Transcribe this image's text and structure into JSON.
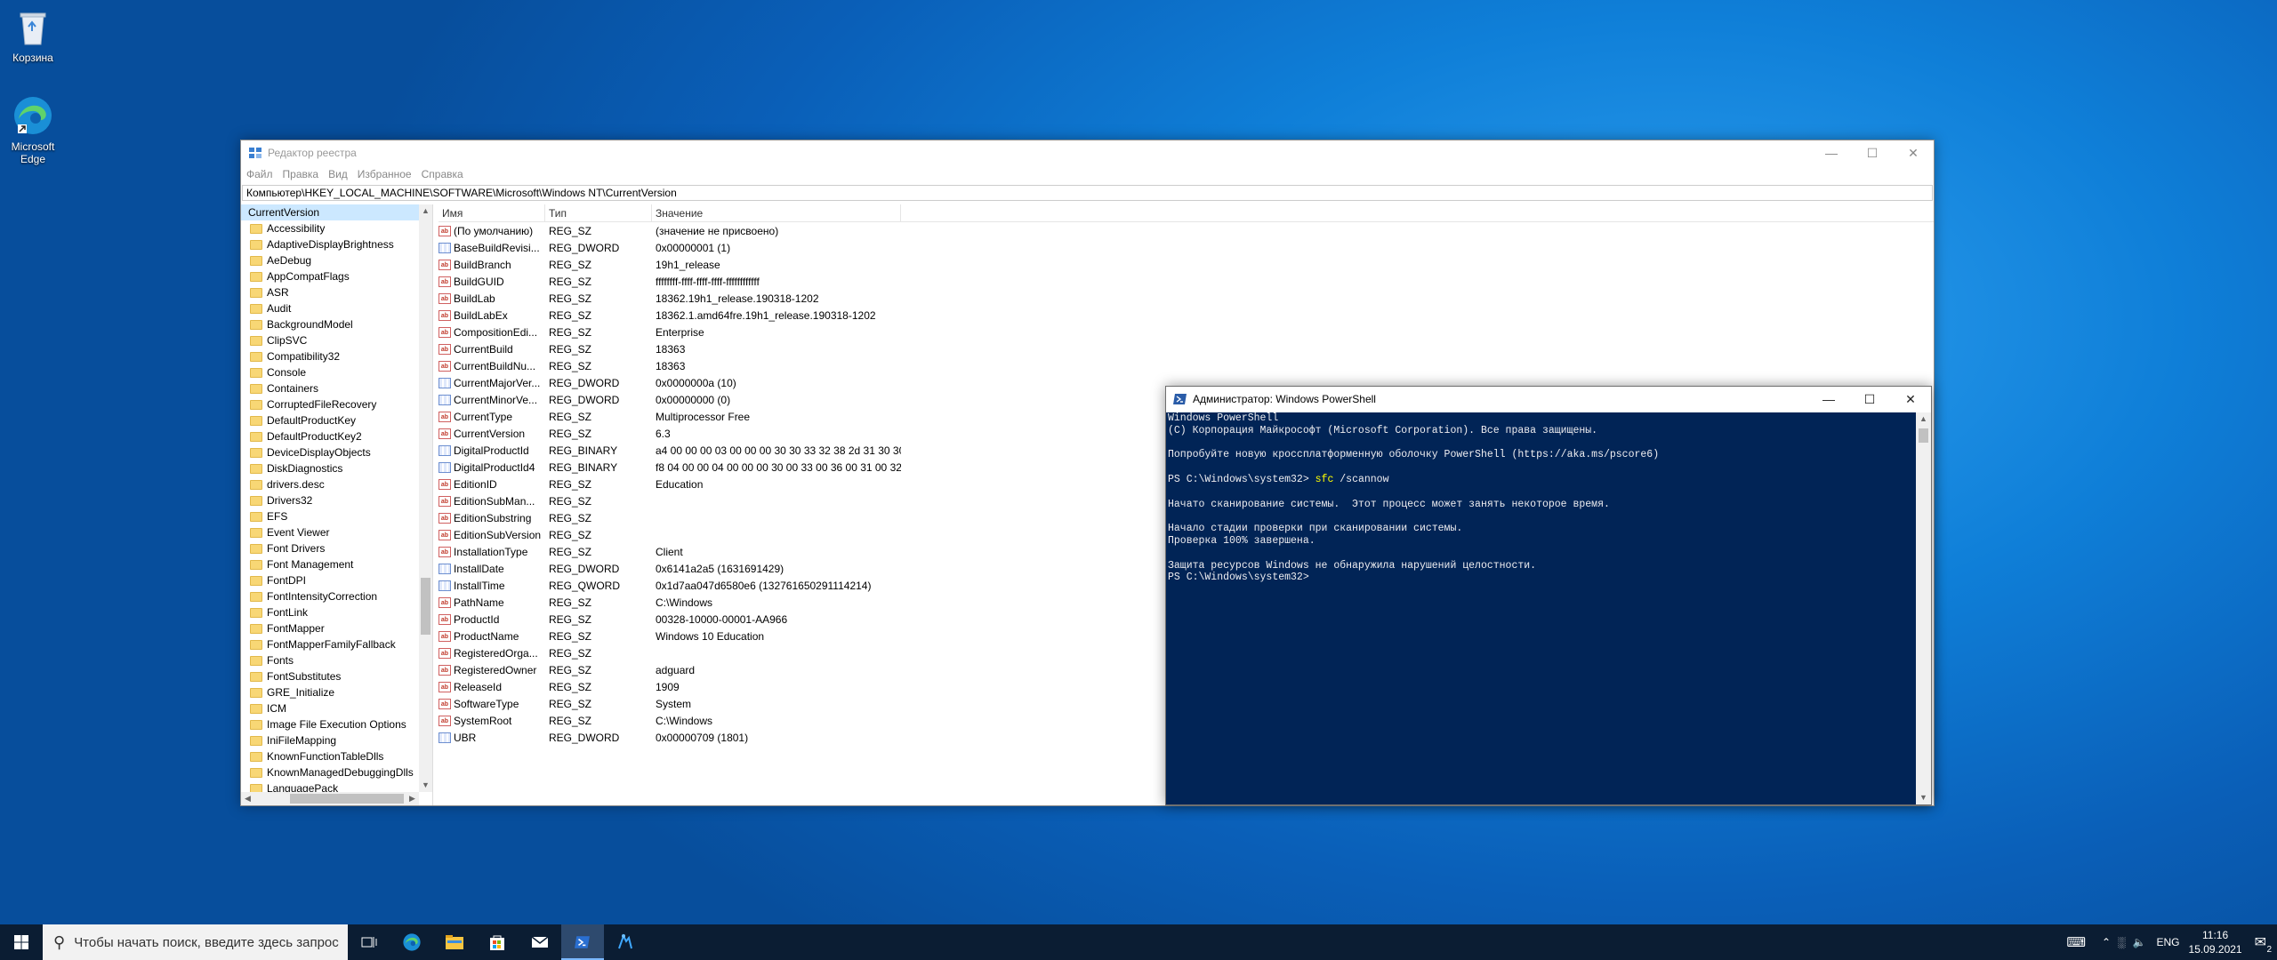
{
  "desktop": {
    "recycle_bin": "Корзина",
    "edge": "Microsoft Edge"
  },
  "regedit": {
    "title": "Редактор реестра",
    "menu": [
      "Файл",
      "Правка",
      "Вид",
      "Избранное",
      "Справка"
    ],
    "address": "Компьютер\\HKEY_LOCAL_MACHINE\\SOFTWARE\\Microsoft\\Windows NT\\CurrentVersion",
    "tree": [
      "CurrentVersion",
      "Accessibility",
      "AdaptiveDisplayBrightness",
      "AeDebug",
      "AppCompatFlags",
      "ASR",
      "Audit",
      "BackgroundModel",
      "ClipSVC",
      "Compatibility32",
      "Console",
      "Containers",
      "CorruptedFileRecovery",
      "DefaultProductKey",
      "DefaultProductKey2",
      "DeviceDisplayObjects",
      "DiskDiagnostics",
      "drivers.desc",
      "Drivers32",
      "EFS",
      "Event Viewer",
      "Font Drivers",
      "Font Management",
      "FontDPI",
      "FontIntensityCorrection",
      "FontLink",
      "FontMapper",
      "FontMapperFamilyFallback",
      "Fonts",
      "FontSubstitutes",
      "GRE_Initialize",
      "ICM",
      "Image File Execution Options",
      "IniFileMapping",
      "KnownFunctionTableDlls",
      "KnownManagedDebuggingDlls",
      "LanguagePack"
    ],
    "headers": [
      "Имя",
      "Тип",
      "Значение"
    ],
    "rows": [
      {
        "icon": "ab",
        "name": "(По умолчанию)",
        "type": "REG_SZ",
        "value": "(значение не присвоено)"
      },
      {
        "icon": "bin",
        "name": "BaseBuildRevisi...",
        "type": "REG_DWORD",
        "value": "0x00000001 (1)"
      },
      {
        "icon": "ab",
        "name": "BuildBranch",
        "type": "REG_SZ",
        "value": "19h1_release"
      },
      {
        "icon": "ab",
        "name": "BuildGUID",
        "type": "REG_SZ",
        "value": "ffffffff-ffff-ffff-ffff-ffffffffffff"
      },
      {
        "icon": "ab",
        "name": "BuildLab",
        "type": "REG_SZ",
        "value": "18362.19h1_release.190318-1202"
      },
      {
        "icon": "ab",
        "name": "BuildLabEx",
        "type": "REG_SZ",
        "value": "18362.1.amd64fre.19h1_release.190318-1202"
      },
      {
        "icon": "ab",
        "name": "CompositionEdi...",
        "type": "REG_SZ",
        "value": "Enterprise"
      },
      {
        "icon": "ab",
        "name": "CurrentBuild",
        "type": "REG_SZ",
        "value": "18363"
      },
      {
        "icon": "ab",
        "name": "CurrentBuildNu...",
        "type": "REG_SZ",
        "value": "18363"
      },
      {
        "icon": "bin",
        "name": "CurrentMajorVer...",
        "type": "REG_DWORD",
        "value": "0x0000000a (10)"
      },
      {
        "icon": "bin",
        "name": "CurrentMinorVe...",
        "type": "REG_DWORD",
        "value": "0x00000000 (0)"
      },
      {
        "icon": "ab",
        "name": "CurrentType",
        "type": "REG_SZ",
        "value": "Multiprocessor Free"
      },
      {
        "icon": "ab",
        "name": "CurrentVersion",
        "type": "REG_SZ",
        "value": "6.3"
      },
      {
        "icon": "bin",
        "name": "DigitalProductId",
        "type": "REG_BINARY",
        "value": "a4 00 00 00 03 00 00 00 30 30 33 32 38 2d 31 30 30 3..."
      },
      {
        "icon": "bin",
        "name": "DigitalProductId4",
        "type": "REG_BINARY",
        "value": "f8 04 00 00 04 00 00 00 30 00 33 00 36 00 31 00 32 00..."
      },
      {
        "icon": "ab",
        "name": "EditionID",
        "type": "REG_SZ",
        "value": "Education"
      },
      {
        "icon": "ab",
        "name": "EditionSubMan...",
        "type": "REG_SZ",
        "value": ""
      },
      {
        "icon": "ab",
        "name": "EditionSubstring",
        "type": "REG_SZ",
        "value": ""
      },
      {
        "icon": "ab",
        "name": "EditionSubVersion",
        "type": "REG_SZ",
        "value": ""
      },
      {
        "icon": "ab",
        "name": "InstallationType",
        "type": "REG_SZ",
        "value": "Client"
      },
      {
        "icon": "bin",
        "name": "InstallDate",
        "type": "REG_DWORD",
        "value": "0x6141a2a5 (1631691429)"
      },
      {
        "icon": "bin",
        "name": "InstallTime",
        "type": "REG_QWORD",
        "value": "0x1d7aa047d6580e6 (132761650291114214)"
      },
      {
        "icon": "ab",
        "name": "PathName",
        "type": "REG_SZ",
        "value": "C:\\Windows"
      },
      {
        "icon": "ab",
        "name": "ProductId",
        "type": "REG_SZ",
        "value": "00328-10000-00001-AA966"
      },
      {
        "icon": "ab",
        "name": "ProductName",
        "type": "REG_SZ",
        "value": "Windows 10 Education"
      },
      {
        "icon": "ab",
        "name": "RegisteredOrga...",
        "type": "REG_SZ",
        "value": ""
      },
      {
        "icon": "ab",
        "name": "RegisteredOwner",
        "type": "REG_SZ",
        "value": "adguard"
      },
      {
        "icon": "ab",
        "name": "ReleaseId",
        "type": "REG_SZ",
        "value": "1909"
      },
      {
        "icon": "ab",
        "name": "SoftwareType",
        "type": "REG_SZ",
        "value": "System"
      },
      {
        "icon": "ab",
        "name": "SystemRoot",
        "type": "REG_SZ",
        "value": "C:\\Windows"
      },
      {
        "icon": "bin",
        "name": "UBR",
        "type": "REG_DWORD",
        "value": "0x00000709 (1801)"
      }
    ]
  },
  "powershell": {
    "title": "Администратор: Windows PowerShell",
    "lines": [
      {
        "text": "Windows PowerShell"
      },
      {
        "text": "(C) Корпорация Майкрософт (Microsoft Corporation). Все права защищены."
      },
      {
        "text": ""
      },
      {
        "text": "Попробуйте новую кроссплатформенную оболочку PowerShell (https://aka.ms/pscore6)"
      },
      {
        "text": ""
      },
      {
        "prompt": "PS C:\\Windows\\system32> ",
        "cmd": "sfc",
        "args": " /scannow"
      },
      {
        "text": ""
      },
      {
        "text": "Начато сканирование системы.  Этот процесс может занять некоторое время."
      },
      {
        "text": ""
      },
      {
        "text": "Начало стадии проверки при сканировании системы."
      },
      {
        "text": "Проверка 100% завершена."
      },
      {
        "text": ""
      },
      {
        "text": "Защита ресурсов Windows не обнаружила нарушений целостности."
      },
      {
        "text": "PS C:\\Windows\\system32>"
      }
    ]
  },
  "taskbar": {
    "search_placeholder": "Чтобы начать поиск, введите здесь запрос",
    "lang": "ENG",
    "time": "11:16",
    "date": "15.09.2021",
    "notification_count": "2"
  }
}
